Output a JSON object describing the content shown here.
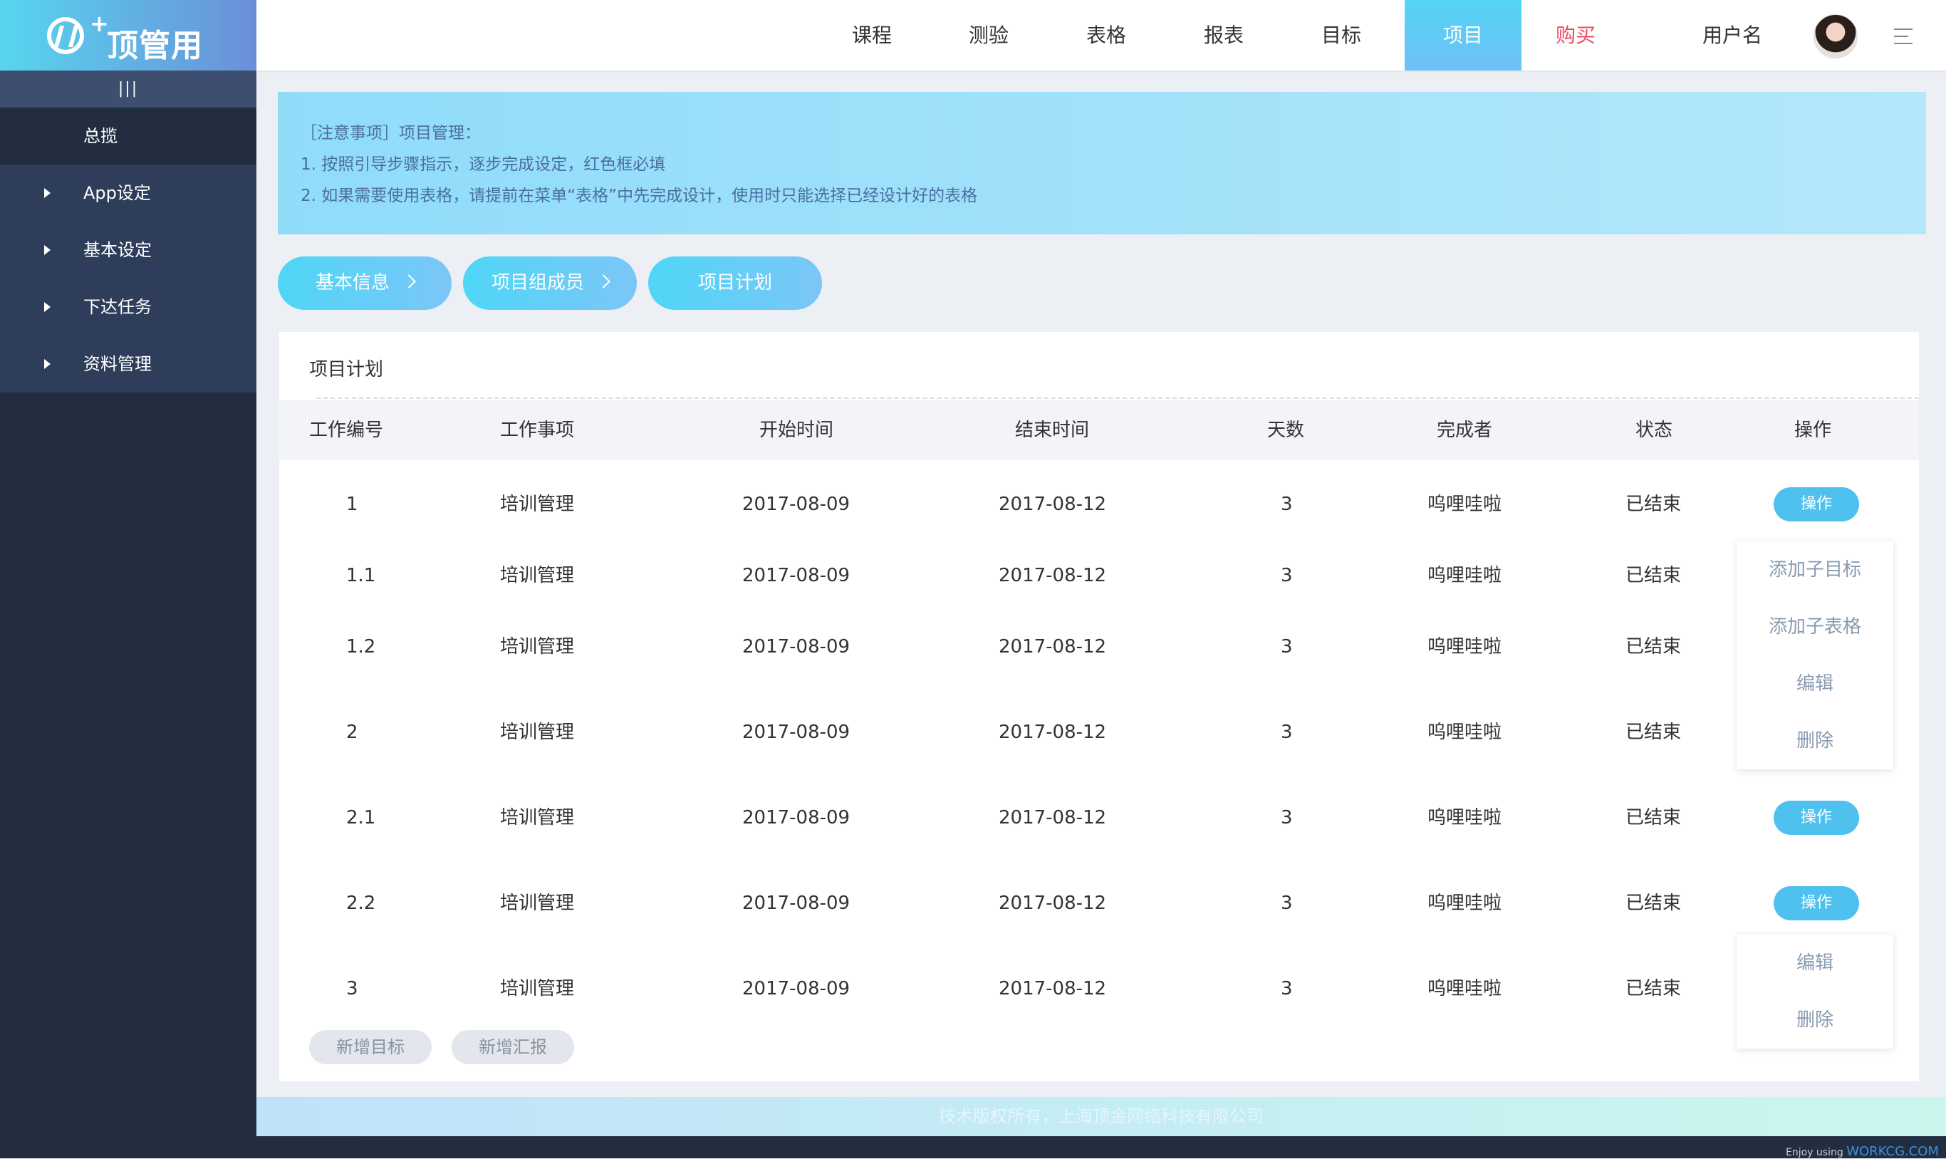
{
  "brand": {
    "logo_text": "顶管用",
    "logo_plus": "+"
  },
  "sidebar": {
    "collapse_label": "|||",
    "items": [
      {
        "label": "总揽"
      },
      {
        "label": "App设定"
      },
      {
        "label": "基本设定"
      },
      {
        "label": "下达任务"
      },
      {
        "label": "资料管理"
      }
    ]
  },
  "topnav": {
    "items": [
      {
        "label": "课程"
      },
      {
        "label": "测验"
      },
      {
        "label": "表格"
      },
      {
        "label": "报表"
      },
      {
        "label": "目标"
      },
      {
        "label": "项目"
      },
      {
        "label": "购买"
      }
    ],
    "active": "项目",
    "username": "用户名"
  },
  "notice": {
    "line1": "［注意事项］项目管理：",
    "line2": "1. 按照引导步骤指示，逐步完成设定，红色框必填",
    "line3": "2. 如果需要使用表格，请提前在菜单“表格”中先完成设计，使用时只能选择已经设计好的表格"
  },
  "steps": [
    {
      "label": "基本信息"
    },
    {
      "label": "项目组成员"
    },
    {
      "label": "项目计划"
    }
  ],
  "panel": {
    "title": "项目计划",
    "columns": [
      "工作编号",
      "工作事项",
      "开始时间",
      "结束时间",
      "天数",
      "完成者",
      "状态",
      "操作"
    ],
    "rows": [
      {
        "id": "1",
        "task": "培训管理",
        "start": "2017-08-09",
        "end": "2017-08-12",
        "days": "3",
        "owner": "呜哩哇啦",
        "status": "已结束",
        "op": "操作"
      },
      {
        "id": "1.1",
        "task": "培训管理",
        "start": "2017-08-09",
        "end": "2017-08-12",
        "days": "3",
        "owner": "呜哩哇啦",
        "status": "已结束",
        "op": ""
      },
      {
        "id": "1.2",
        "task": "培训管理",
        "start": "2017-08-09",
        "end": "2017-08-12",
        "days": "3",
        "owner": "呜哩哇啦",
        "status": "已结束",
        "op": ""
      },
      {
        "id": "2",
        "task": "培训管理",
        "start": "2017-08-09",
        "end": "2017-08-12",
        "days": "3",
        "owner": "呜哩哇啦",
        "status": "已结束",
        "op": ""
      },
      {
        "id": "2.1",
        "task": "培训管理",
        "start": "2017-08-09",
        "end": "2017-08-12",
        "days": "3",
        "owner": "呜哩哇啦",
        "status": "已结束",
        "op": "操作"
      },
      {
        "id": "2.2",
        "task": "培训管理",
        "start": "2017-08-09",
        "end": "2017-08-12",
        "days": "3",
        "owner": "呜哩哇啦",
        "status": "已结束",
        "op": "操作"
      },
      {
        "id": "3",
        "task": "培训管理",
        "start": "2017-08-09",
        "end": "2017-08-12",
        "days": "3",
        "owner": "呜哩哇啦",
        "status": "已结束",
        "op": ""
      }
    ],
    "dropdown_1": [
      "添加子目标",
      "添加子表格",
      "编辑",
      "删除"
    ],
    "dropdown_2": [
      "编辑",
      "删除"
    ],
    "add_goal": "新增目标",
    "add_report": "新增汇报"
  },
  "footer": {
    "copyright": "技术版权所有，上海顶金网络科技有限公司"
  },
  "credit": {
    "prefix": "Enjoy using",
    "brand": "WORKCG.COM"
  },
  "colors": {
    "accent": "#4fc1ef",
    "sidebar": "#222e40",
    "buy": "#f04864"
  }
}
